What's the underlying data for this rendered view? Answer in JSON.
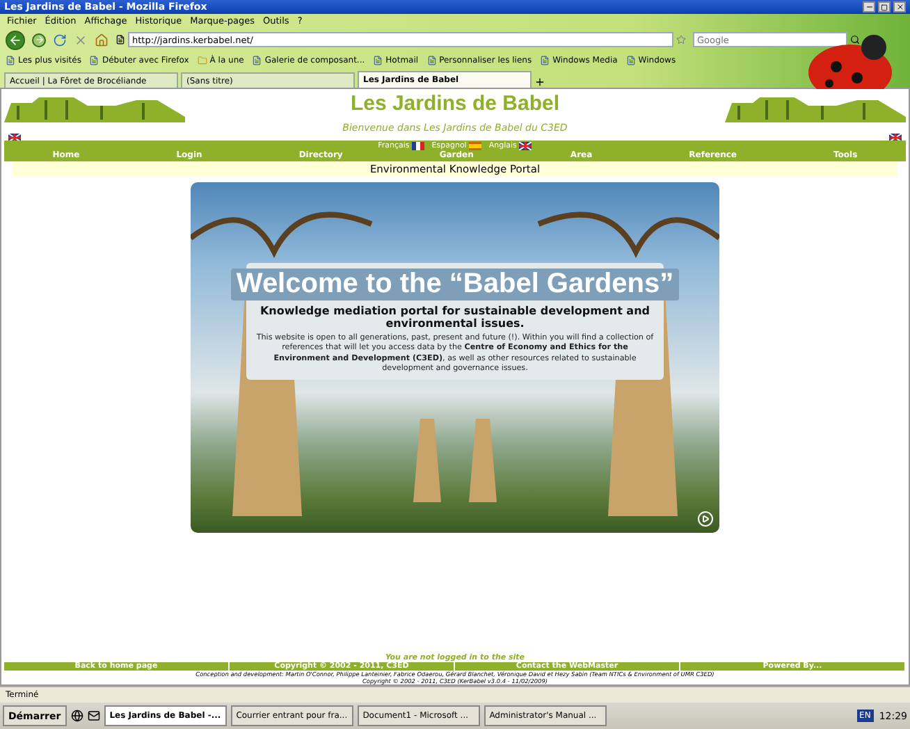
{
  "window": {
    "title": "Les Jardins de Babel - Mozilla Firefox"
  },
  "menu": [
    "Fichier",
    "Édition",
    "Affichage",
    "Historique",
    "Marque-pages",
    "Outils",
    "?"
  ],
  "address": {
    "value": "http://jardins.kerbabel.net/"
  },
  "search": {
    "placeholder": "Google"
  },
  "bookmarks": [
    "Les plus visités",
    "Débuter avec Firefox",
    "À la une",
    "Galerie de composant...",
    "Hotmail",
    "Personnaliser les liens",
    "Windows Media",
    "Windows"
  ],
  "tabs": [
    {
      "label": "Accueil | La Fôret de Brocéliande",
      "selected": false
    },
    {
      "label": "(Sans titre)",
      "selected": false
    },
    {
      "label": "Les Jardins de Babel",
      "selected": true
    }
  ],
  "site": {
    "title": "Les Jardins de Babel",
    "subtitle": "Bienvenue dans Les Jardins de Babel du C3ED"
  },
  "languages": [
    "Français",
    "Espagnol",
    "Anglais"
  ],
  "nav": [
    "Home",
    "Login",
    "Directory",
    "Garden",
    "Area",
    "Reference",
    "Tools"
  ],
  "portal_title": "Environmental Knowledge Portal",
  "banner": {
    "heading": "Welcome to the “Babel Gardens”",
    "subheading": "Knowledge mediation portal for sustainable development and environmental issues.",
    "body": "This website is open to all generations, past, present and future (!). Within you will find a collection of references that will let you access data by the **Centre of Economy and Ethics for the Environment and Development (C3ED)**, as well as other resources related to sustainable development and governance issues."
  },
  "login_status": "You are not logged in to the site",
  "footer_links": [
    "Back to home page",
    "Copyright © 2002 - 2011, C3ED",
    "Contact the WebMaster",
    "Powered By..."
  ],
  "credits": [
    "Conception and development: Martin O'Connor, Philippe Lanteinier, Fabrice Odaerou, Gérard Blanchet, Véronique David et Hezy Sabin (Team NTICs & Environment of UMR C3ED)",
    "Copyright © 2002 - 2011, C3ED (KerBabel v3.0.4 - 11/02/2009)"
  ],
  "status_bar": "Terminé",
  "taskbar": {
    "start": "Démarrer",
    "tasks": [
      {
        "label": "Les Jardins de Babel -...",
        "selected": true
      },
      {
        "label": "Courrier entrant pour fra...",
        "selected": false
      },
      {
        "label": "Document1 - Microsoft ...",
        "selected": false
      },
      {
        "label": "Administrator's Manual ...",
        "selected": false
      }
    ],
    "language": "EN",
    "clock": "12:29"
  }
}
